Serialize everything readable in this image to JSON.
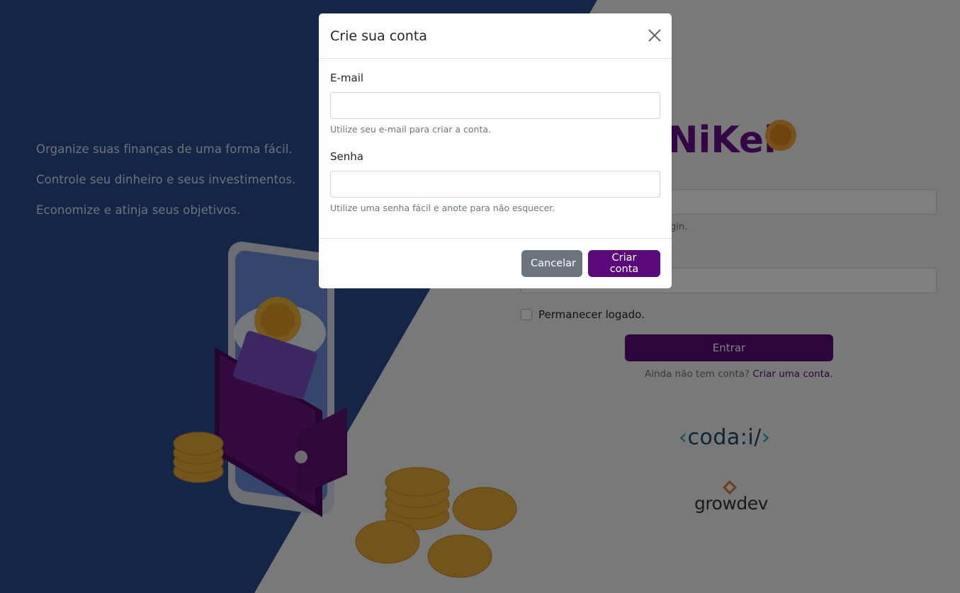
{
  "background": {
    "taglines": [
      "Organize suas finanças de uma forma fácil.",
      "Controle seu dinheiro e seus investimentos.",
      "Economize e atinja seus objetivos."
    ],
    "colors": {
      "blue": "#2b4a8f",
      "light": "#f2f2f2",
      "purple": "#5a0a7a"
    }
  },
  "login": {
    "logo_text": "NiKel",
    "email_hint_fragment": "gin.",
    "remember_label": "Permanecer logado.",
    "enter_button": "Entrar",
    "no_account_text": "Ainda não tem conta?",
    "create_account_link": "Criar uma conta.",
    "partners": {
      "coda": "coda:i/",
      "growdev": "growdev"
    }
  },
  "modal": {
    "title": "Crie sua conta",
    "email": {
      "label": "E-mail",
      "value": "",
      "hint": "Utilize seu e-mail para criar a conta."
    },
    "password": {
      "label": "Senha",
      "value": "",
      "hint": "Utilize uma senha fácil e anote para não esquecer."
    },
    "cancel_button": "Cancelar",
    "create_button": "Criar conta"
  }
}
